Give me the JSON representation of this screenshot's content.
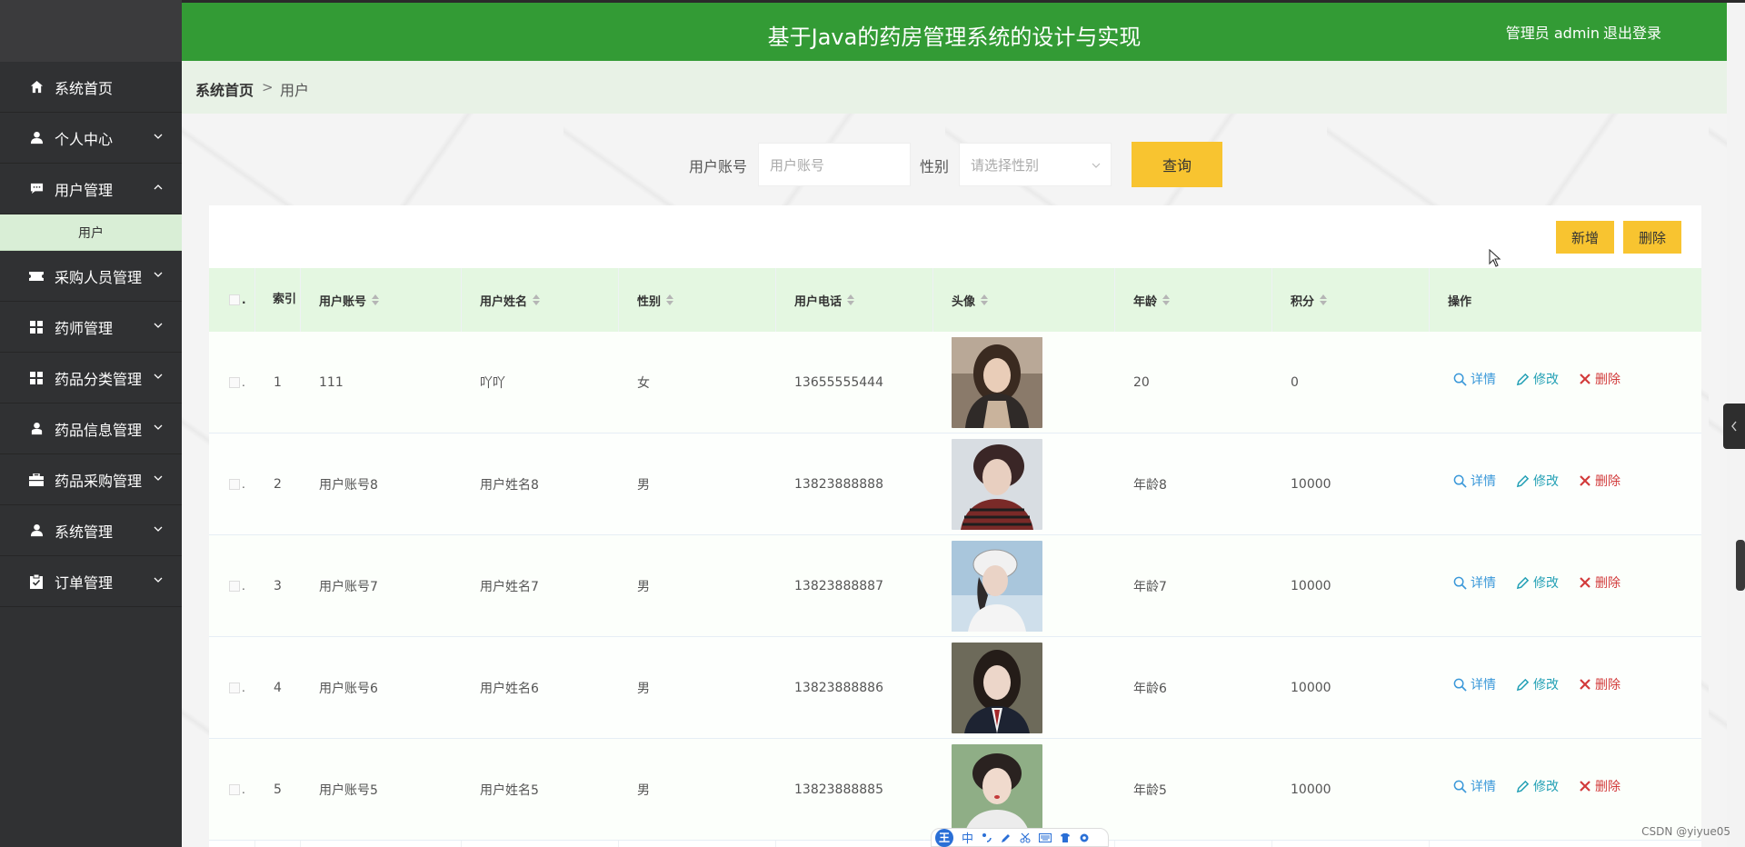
{
  "header": {
    "title": "基于Java的药房管理系统的设计与实现",
    "user": "管理员 admin",
    "logout": "退出登录"
  },
  "sidebar": {
    "items": [
      {
        "label": "系统首页",
        "icon": "home-icon",
        "chevron": ""
      },
      {
        "label": "个人中心",
        "icon": "user-icon",
        "chevron": "down"
      },
      {
        "label": "用户管理",
        "icon": "chat-icon",
        "chevron": "up"
      },
      {
        "label": "采购人员管理",
        "icon": "ticket-icon",
        "chevron": "down"
      },
      {
        "label": "药师管理",
        "icon": "grid-icon",
        "chevron": "down"
      },
      {
        "label": "药品分类管理",
        "icon": "grid-icon",
        "chevron": "down"
      },
      {
        "label": "药品信息管理",
        "icon": "person-icon",
        "chevron": "down"
      },
      {
        "label": "药品采购管理",
        "icon": "briefcase-icon",
        "chevron": "down"
      },
      {
        "label": "系统管理",
        "icon": "user-icon",
        "chevron": "down"
      },
      {
        "label": "订单管理",
        "icon": "clipboard-icon",
        "chevron": "down"
      }
    ],
    "subitem": "用户"
  },
  "breadcrumb": {
    "home": "系统首页",
    "separator": ">",
    "current": "用户"
  },
  "search": {
    "account_label": "用户账号",
    "account_placeholder": "用户账号",
    "gender_label": "性别",
    "gender_placeholder": "请选择性别",
    "query_button": "查询"
  },
  "toolbar": {
    "add_label": "新增",
    "delete_label": "删除"
  },
  "table": {
    "columns": [
      "索引",
      "用户账号",
      "用户姓名",
      "性别",
      "用户电话",
      "头像",
      "年龄",
      "积分",
      "操作"
    ],
    "rows": [
      {
        "index": "1",
        "account": "111",
        "name": "吖吖",
        "gender": "女",
        "phone": "13655555444",
        "age": "20",
        "points": "0"
      },
      {
        "index": "2",
        "account": "用户账号8",
        "name": "用户姓名8",
        "gender": "男",
        "phone": "13823888888",
        "age": "年龄8",
        "points": "10000"
      },
      {
        "index": "3",
        "account": "用户账号7",
        "name": "用户姓名7",
        "gender": "男",
        "phone": "13823888887",
        "age": "年龄7",
        "points": "10000"
      },
      {
        "index": "4",
        "account": "用户账号6",
        "name": "用户姓名6",
        "gender": "男",
        "phone": "13823888886",
        "age": "年龄6",
        "points": "10000"
      },
      {
        "index": "5",
        "account": "用户账号5",
        "name": "用户姓名5",
        "gender": "男",
        "phone": "13823888885",
        "age": "年龄5",
        "points": "10000"
      }
    ],
    "actions": {
      "detail": "详情",
      "edit": "修改",
      "delete": "删除"
    }
  },
  "ime": {
    "logo": "王",
    "mode": "中"
  },
  "watermark": "CSDN @yiyue05",
  "colors": {
    "header_green": "#339b35",
    "sidebar_dark": "#303133",
    "button_yellow": "#f8c430",
    "table_header_green": "#e4f7e1"
  }
}
